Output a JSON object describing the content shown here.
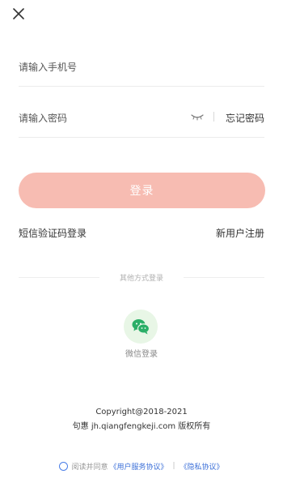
{
  "theme": {
    "login_button_color": "#f7bcb2",
    "accent_blue": "#3b6fd8",
    "wechat_green": "#2aae67",
    "wechat_bg": "#e8f6e6"
  },
  "header": {
    "close_icon": "close-icon"
  },
  "phone": {
    "placeholder": "请输入手机号",
    "value": ""
  },
  "password": {
    "placeholder": "请输入密码",
    "value": "",
    "eye_icon": "eye-closed-icon",
    "forgot_label": "忘记密码"
  },
  "login": {
    "button_label": "登录"
  },
  "links": {
    "sms_login": "短信验证码登录",
    "register": "新用户注册"
  },
  "other_login": {
    "label": "其他方式登录",
    "wechat_icon": "wechat-icon",
    "wechat_label": "微信登录"
  },
  "footer": {
    "copyright_line1": "Copyright@2018-2021",
    "copyright_line2": "句惠 jh.qiangfengkeji.com 版权所有",
    "agree_prefix": "阅读并同意",
    "user_agreement": "《用户服务协议》",
    "separator": "|",
    "privacy_agreement": "《隐私协议》"
  }
}
